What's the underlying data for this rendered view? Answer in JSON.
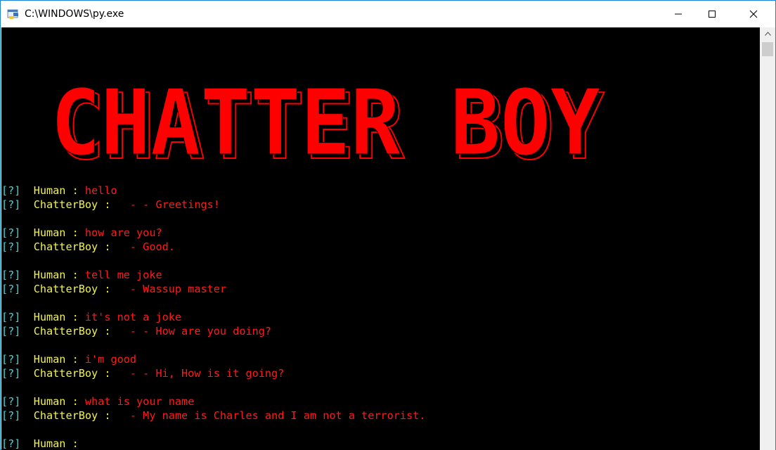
{
  "window": {
    "title": "C:\\WINDOWS\\py.exe"
  },
  "banner": {
    "text": "CHATTER BOY",
    "color": "#ff0000"
  },
  "console": {
    "prompt_marker": "[?]",
    "conversation": [
      {
        "speaker": "Human",
        "sep": " : ",
        "text": "hello"
      },
      {
        "speaker": "ChatterBoy",
        "sep": " :   ",
        "text": "- - Greetings!"
      },
      {
        "blank": true
      },
      {
        "speaker": "Human",
        "sep": " : ",
        "text": "how are you?"
      },
      {
        "speaker": "ChatterBoy",
        "sep": " :   ",
        "text": "- Good."
      },
      {
        "blank": true
      },
      {
        "speaker": "Human",
        "sep": " : ",
        "text": "tell me joke"
      },
      {
        "speaker": "ChatterBoy",
        "sep": " :   ",
        "text": "- Wassup master"
      },
      {
        "blank": true
      },
      {
        "speaker": "Human",
        "sep": " : ",
        "text": "it's not a joke"
      },
      {
        "speaker": "ChatterBoy",
        "sep": " :   ",
        "text": "- - How are you doing?"
      },
      {
        "blank": true
      },
      {
        "speaker": "Human",
        "sep": " : ",
        "text": "i'm good"
      },
      {
        "speaker": "ChatterBoy",
        "sep": " :   ",
        "text": "- - Hi, How is it going?"
      },
      {
        "blank": true
      },
      {
        "speaker": "Human",
        "sep": " : ",
        "text": "what is your name"
      },
      {
        "speaker": "ChatterBoy",
        "sep": " :   ",
        "text": "- My name is Charles and I am not a terrorist."
      },
      {
        "blank": true
      },
      {
        "speaker": "Human",
        "sep": " :",
        "text": ""
      }
    ]
  },
  "colors": {
    "console_bg": "#000000",
    "prompt_marker": "#3ad7df",
    "speaker": "#f2f24a",
    "message": "#ff1a1a"
  },
  "icons": {
    "app": "python-icon",
    "minimize": "minimize-icon",
    "maximize": "maximize-icon",
    "close": "close-icon",
    "scroll_up": "chevron-up-icon"
  }
}
